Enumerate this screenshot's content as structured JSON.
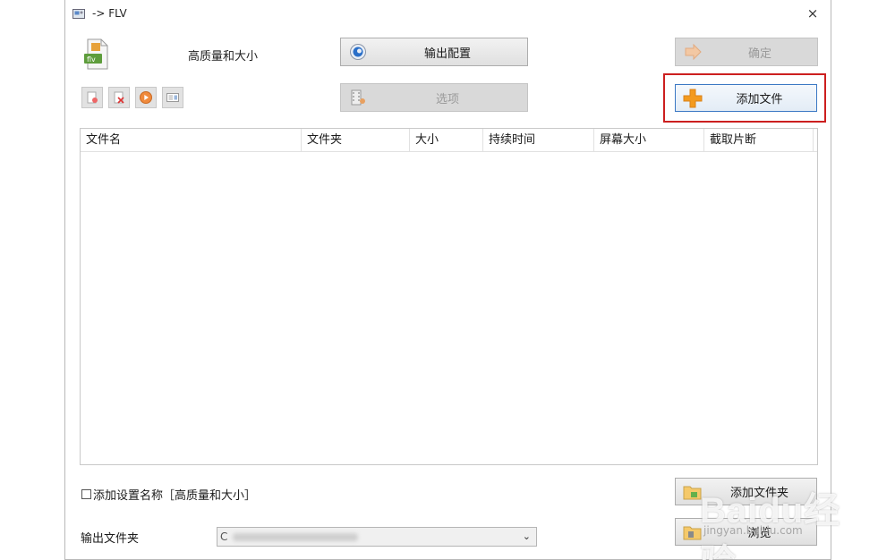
{
  "window": {
    "title": "-> FLV",
    "close_label": "×"
  },
  "profile": {
    "name": "高质量和大小",
    "icon": "flv-file-icon"
  },
  "buttons": {
    "output_config": "输出配置",
    "options": "选项",
    "confirm": "确定",
    "add_file": "添加文件",
    "add_folder": "添加文件夹",
    "browse": "浏览"
  },
  "toolbar_icons": [
    "remove-file-icon",
    "clear-list-icon",
    "play-icon",
    "media-info-icon"
  ],
  "file_table": {
    "columns": [
      "文件名",
      "文件夹",
      "大小",
      "持续时间",
      "屏幕大小",
      "截取片断"
    ],
    "rows": []
  },
  "add_setting_name": {
    "label": "添加设置名称［高质量和大小］",
    "checked": false
  },
  "output_folder": {
    "label": "输出文件夹",
    "value": "C"
  },
  "watermark": {
    "text": "Baidu经验",
    "sub": "jingyan.baidu.com"
  },
  "colors": {
    "highlight": "#cc1f1f",
    "add_icon": "#f39a1e",
    "config_icon": "#2a6fc8"
  }
}
